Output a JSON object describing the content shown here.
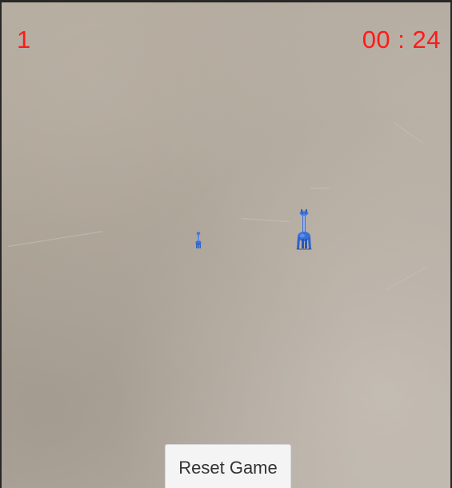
{
  "hud": {
    "score": "1",
    "timer": "00 : 24",
    "text_color": "#ff1a1a"
  },
  "scene": {
    "background": "camera-feed-beige-wall",
    "figures": [
      {
        "name": "blue-giraffe-figure-small",
        "color": "#3a6fd8"
      },
      {
        "name": "blue-giraffe-figure-large",
        "color": "#3a6fd8"
      }
    ]
  },
  "controls": {
    "reset_label": "Reset Game"
  }
}
